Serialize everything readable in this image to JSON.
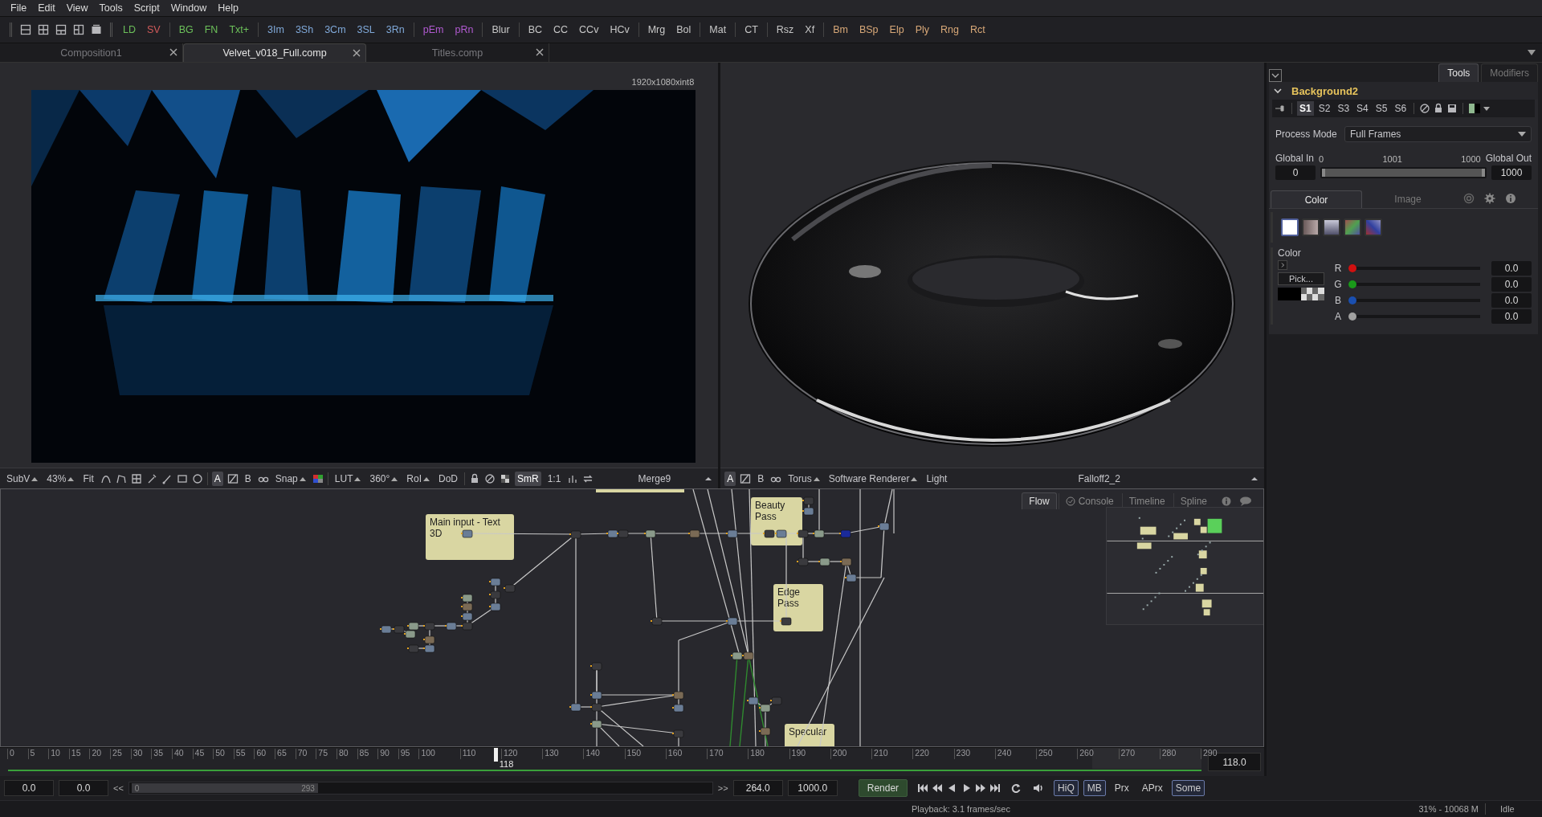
{
  "menu": [
    "File",
    "Edit",
    "View",
    "Tools",
    "Script",
    "Window",
    "Help"
  ],
  "toolbar": [
    [
      {
        "label": "LD",
        "color": "#6cc05a"
      },
      {
        "label": "SV",
        "color": "#d05a5a"
      }
    ],
    [
      {
        "label": "BG",
        "color": "#6cc05a"
      },
      {
        "label": "FN",
        "color": "#6cc05a"
      },
      {
        "label": "Txt+",
        "color": "#6cc05a"
      }
    ],
    [
      {
        "label": "3Im",
        "color": "#7fa8d8"
      },
      {
        "label": "3Sh",
        "color": "#7fa8d8"
      },
      {
        "label": "3Cm",
        "color": "#7fa8d8"
      },
      {
        "label": "3SL",
        "color": "#7fa8d8"
      },
      {
        "label": "3Rn",
        "color": "#7fa8d8"
      }
    ],
    [
      {
        "label": "pEm",
        "color": "#b05ad0"
      },
      {
        "label": "pRn",
        "color": "#b05ad0"
      }
    ],
    [
      {
        "label": "Blur",
        "color": "#c8c8c8"
      }
    ],
    [
      {
        "label": "BC",
        "color": "#c8c8c8"
      },
      {
        "label": "CC",
        "color": "#c8c8c8"
      },
      {
        "label": "CCv",
        "color": "#c8c8c8"
      },
      {
        "label": "HCv",
        "color": "#c8c8c8"
      }
    ],
    [
      {
        "label": "Mrg",
        "color": "#c8c8c8"
      },
      {
        "label": "Bol",
        "color": "#c8c8c8"
      }
    ],
    [
      {
        "label": "Mat",
        "color": "#c8c8c8"
      }
    ],
    [
      {
        "label": "CT",
        "color": "#c8c8c8"
      }
    ],
    [
      {
        "label": "Rsz",
        "color": "#c8c8c8"
      },
      {
        "label": "Xf",
        "color": "#c8c8c8"
      }
    ],
    [
      {
        "label": "Bm",
        "color": "#d8a878"
      },
      {
        "label": "BSp",
        "color": "#d8a878"
      },
      {
        "label": "Elp",
        "color": "#d8a878"
      },
      {
        "label": "Ply",
        "color": "#d8a878"
      },
      {
        "label": "Rng",
        "color": "#d8a878"
      },
      {
        "label": "Rct",
        "color": "#d8a878"
      }
    ]
  ],
  "doc_tabs": [
    {
      "label": "Composition1",
      "selected": false
    },
    {
      "label": "Velvet_v018_Full.comp",
      "selected": true
    },
    {
      "label": "Titles.comp",
      "selected": false
    }
  ],
  "viewer": {
    "resolution": "1920x1080xint8"
  },
  "viewer_toolbars": [
    {
      "items": [
        {
          "kind": "menu",
          "label": "SubV"
        },
        {
          "kind": "menu",
          "label": "43%"
        },
        {
          "kind": "button",
          "label": "Fit"
        },
        {
          "kind": "toggle",
          "label": "A",
          "selected": true
        },
        {
          "kind": "toggle",
          "label": "B",
          "selected": false
        },
        {
          "kind": "menu",
          "label": "Snap"
        },
        {
          "kind": "menu",
          "label": "LUT"
        },
        {
          "kind": "menu",
          "label": "360°"
        },
        {
          "kind": "menu",
          "label": "RoI"
        },
        {
          "kind": "button",
          "label": "DoD"
        },
        {
          "kind": "toggle",
          "label": "SmR",
          "selected": true
        },
        {
          "kind": "button",
          "label": "1:1"
        },
        {
          "kind": "label",
          "label": "Merge9"
        }
      ]
    },
    {
      "items": [
        {
          "kind": "toggle",
          "label": "A",
          "selected": true
        },
        {
          "kind": "toggle",
          "label": "B",
          "selected": false
        },
        {
          "kind": "menu",
          "label": "Torus"
        },
        {
          "kind": "menu",
          "label": "Software Renderer"
        },
        {
          "kind": "button",
          "label": "Light"
        },
        {
          "kind": "label",
          "label": "Falloff2_2"
        }
      ]
    }
  ],
  "flow": {
    "tabs": [
      {
        "label": "Flow",
        "selected": true
      },
      {
        "label": "Console",
        "selected": false
      },
      {
        "label": "Timeline",
        "selected": false
      },
      {
        "label": "Spline",
        "selected": false
      }
    ],
    "notes": [
      "Main input - Text 3D",
      "Beauty Pass",
      "Edge Pass",
      "Specular"
    ]
  },
  "timeline": {
    "ticks": [
      "0",
      "5",
      "10",
      "15",
      "20",
      "25",
      "30",
      "35",
      "40",
      "45",
      "50",
      "55",
      "60",
      "65",
      "70",
      "75",
      "80",
      "85",
      "90",
      "95",
      "100",
      "110",
      "120",
      "130",
      "140",
      "150",
      "160",
      "170",
      "180",
      "190",
      "200",
      "210",
      "220",
      "230",
      "240",
      "250",
      "260",
      "270",
      "280",
      "290"
    ],
    "playhead": {
      "label": "118",
      "level": 0.407
    },
    "current_frame": "118.0"
  },
  "transport": {
    "fields": [
      "0.0",
      "0.0"
    ],
    "back": "<<",
    "scroll": [
      "0",
      "293"
    ],
    "forward": ">>",
    "range": [
      "264.0",
      "1000.0"
    ],
    "render": "Render",
    "modes": [
      {
        "label": "HiQ",
        "on": true
      },
      {
        "label": "MB",
        "on": true
      },
      {
        "label": "Prx",
        "on": false
      },
      {
        "label": "APrx",
        "on": false
      },
      {
        "label": "Some",
        "on": true
      }
    ]
  },
  "status": {
    "playback": "Playback: 3.1 frames/sec",
    "memory": "31% - 10068 M",
    "state": "Idle"
  },
  "inspector": {
    "tabs": [
      {
        "label": "Tools",
        "selected": true
      },
      {
        "label": "Modifiers",
        "selected": false
      }
    ],
    "tool": {
      "name": "Background2",
      "expanded": true
    },
    "sets": [
      {
        "label": "S1",
        "selected": true
      },
      {
        "label": "S2",
        "selected": false
      },
      {
        "label": "S3",
        "selected": false
      },
      {
        "label": "S4",
        "selected": false
      },
      {
        "label": "S5",
        "selected": false
      },
      {
        "label": "S6",
        "selected": false
      }
    ],
    "process_mode": {
      "label": "Process Mode",
      "value": "Full Frames"
    },
    "global": {
      "in_label": "Global In",
      "out_label": "Global Out",
      "scale": [
        "0",
        "1001",
        "1000"
      ],
      "in_value": "0",
      "out_value": "1000",
      "level": 1
    },
    "sub_tabs": [
      {
        "label": "Color",
        "selected": true
      },
      {
        "label": "Image",
        "selected": false
      }
    ],
    "swatches": [
      {
        "selected": true
      },
      {
        "selected": false
      },
      {
        "selected": false
      },
      {
        "selected": false
      },
      {
        "selected": false
      }
    ],
    "color": {
      "label": "Color",
      "pick": "Pick...",
      "channels": [
        {
          "name": "R",
          "color": "#d01010",
          "level": 0,
          "value": "0.0"
        },
        {
          "name": "G",
          "color": "#1a9a1a",
          "level": 0,
          "value": "0.0"
        },
        {
          "name": "B",
          "color": "#1a4fb0",
          "level": 0,
          "value": "0.0"
        },
        {
          "name": "A",
          "color": "#a0a0a0",
          "level": 0,
          "value": "0.0"
        }
      ]
    }
  }
}
